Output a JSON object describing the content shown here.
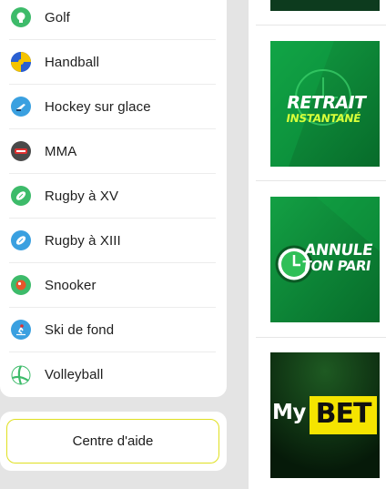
{
  "sports": [
    {
      "label": "Golf",
      "icon": "golf-icon",
      "color": "#3dbb6a"
    },
    {
      "label": "Handball",
      "icon": "handball-icon",
      "color": "#2a5fd1"
    },
    {
      "label": "Hockey sur glace",
      "icon": "ice-hockey-icon",
      "color": "#3aa0e0"
    },
    {
      "label": "MMA",
      "icon": "mma-icon",
      "color": "#4a4a4a"
    },
    {
      "label": "Rugby à XV",
      "icon": "rugby-xv-icon",
      "color": "#3dbb6a"
    },
    {
      "label": "Rugby à XIII",
      "icon": "rugby-xiii-icon",
      "color": "#3aa0e0"
    },
    {
      "label": "Snooker",
      "icon": "snooker-icon",
      "color": "#3dbb6a"
    },
    {
      "label": "Ski de fond",
      "icon": "cross-country-ski-icon",
      "color": "#3aa0e0"
    },
    {
      "label": "Volleyball",
      "icon": "volleyball-icon",
      "color": "#3dbb6a"
    }
  ],
  "help": {
    "label": "Centre d'aide"
  },
  "promos": [
    {
      "line1": "RETRAIT",
      "line2": "INSTANTANÉ"
    },
    {
      "line1": "ANNULE",
      "line2": "TON PARI"
    },
    {
      "word1": "My",
      "word2": "BET"
    }
  ],
  "colors": {
    "accent_yellow": "#f5e400",
    "promo_green": "#0d8a3a"
  }
}
